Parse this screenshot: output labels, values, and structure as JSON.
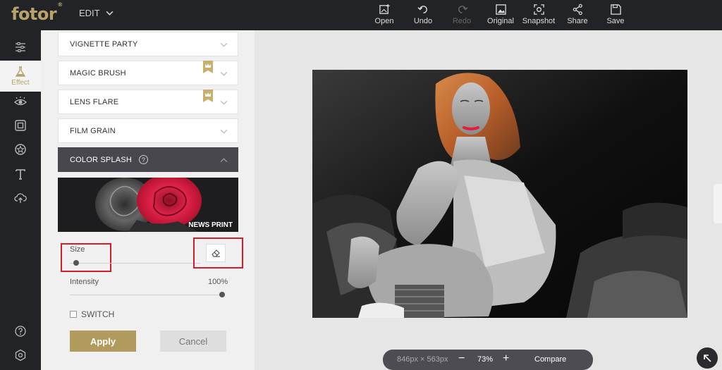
{
  "app": {
    "logo": "fotor",
    "logo_mark": "®",
    "edit_menu": "EDIT"
  },
  "toolbar": [
    {
      "label": "Open",
      "icon": "open-image-icon",
      "disabled": false
    },
    {
      "label": "Undo",
      "icon": "undo-icon",
      "disabled": false
    },
    {
      "label": "Redo",
      "icon": "redo-icon",
      "disabled": true
    },
    {
      "label": "Original",
      "icon": "original-image-icon",
      "disabled": false
    },
    {
      "label": "Snapshot",
      "icon": "snapshot-icon",
      "disabled": false
    },
    {
      "label": "Share",
      "icon": "share-icon",
      "disabled": false
    },
    {
      "label": "Save",
      "icon": "save-icon",
      "disabled": false
    }
  ],
  "sidebar": {
    "active_label": "Effect",
    "items": [
      "adjust-sliders-icon",
      "effect-flask-icon",
      "beauty-eye-icon",
      "frame-icon",
      "sticker-icon",
      "text-icon",
      "cloud-upload-icon"
    ],
    "bottom": [
      "help-icon",
      "settings-icon"
    ]
  },
  "panel": {
    "effects": [
      {
        "label": "VIGNETTE PARTY",
        "premium": false
      },
      {
        "label": "MAGIC BRUSH",
        "premium": true
      },
      {
        "label": "LENS FLARE",
        "premium": true
      },
      {
        "label": "FILM GRAIN",
        "premium": false
      }
    ],
    "active_effect": "COLOR SPLASH",
    "preview_label": "NEWS PRINT",
    "size_label": "Size",
    "size_value": 0.05,
    "intensity_label": "Intensity",
    "intensity_value": "100%",
    "switch_label": "SWITCH",
    "apply": "Apply",
    "cancel": "Cancel"
  },
  "zoom_bar": {
    "dimensions": "846px × 563px",
    "minus": "−",
    "zoom": "73%",
    "plus": "+",
    "compare": "Compare"
  },
  "colors": {
    "accent": "#b8a46a",
    "dark": "#222326",
    "highlight": "#d21e2a"
  }
}
